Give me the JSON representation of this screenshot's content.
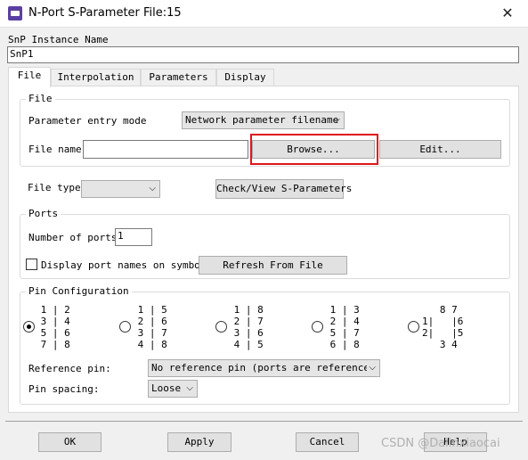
{
  "window": {
    "title": "N-Port S-Parameter File:15",
    "close_glyph": "✕"
  },
  "instance": {
    "label": "SnP Instance Name",
    "value": "SnP1"
  },
  "tabs": [
    {
      "label": "File"
    },
    {
      "label": "Interpolation"
    },
    {
      "label": "Parameters"
    },
    {
      "label": "Display"
    }
  ],
  "file_group": {
    "title": "File",
    "entry_mode_label": "Parameter entry mode",
    "entry_mode_value": "Network parameter filename",
    "file_name_label": "File name",
    "file_name_value": "",
    "browse_label": "Browse...",
    "edit_label": "Edit..."
  },
  "file_type": {
    "label": "File type",
    "value": "",
    "check_view_label": "Check/View S-Parameters"
  },
  "ports_group": {
    "title": "Ports",
    "num_ports_label": "Number of ports",
    "num_ports_value": "1",
    "display_names_label": "Display port names on symbol",
    "display_names_checked": false,
    "refresh_label": "Refresh From File"
  },
  "pin_config": {
    "title": "Pin Configuration",
    "options": [
      {
        "text": " 1 | 2\n 3 | 4\n 5 | 6\n 7 | 8",
        "selected": true
      },
      {
        "text": " 1 | 5\n 2 | 6\n 3 | 7\n 4 | 8",
        "selected": false
      },
      {
        "text": " 1 | 8\n 2 | 7\n 3 | 6\n 4 | 5",
        "selected": false
      },
      {
        "text": " 1 | 3\n 2 | 4\n 5 | 7\n 6 | 8",
        "selected": false
      },
      {
        "text": "   8 7\n1|   |6\n2|   |5\n   3 4",
        "selected": false
      }
    ],
    "ref_pin_label": "Reference pin:",
    "ref_pin_value": "No reference pin (ports are referenced t",
    "spacing_label": "Pin spacing:",
    "spacing_value": "Loose"
  },
  "buttons": {
    "ok": "OK",
    "apply": "Apply",
    "cancel": "Cancel",
    "help": "Help"
  },
  "watermark": "CSDN @Dalinxiaocai",
  "icons": {
    "app": "ads-component-icon",
    "dropdown": "chevron-down-icon"
  },
  "colors": {
    "highlight": "#e0161b"
  }
}
